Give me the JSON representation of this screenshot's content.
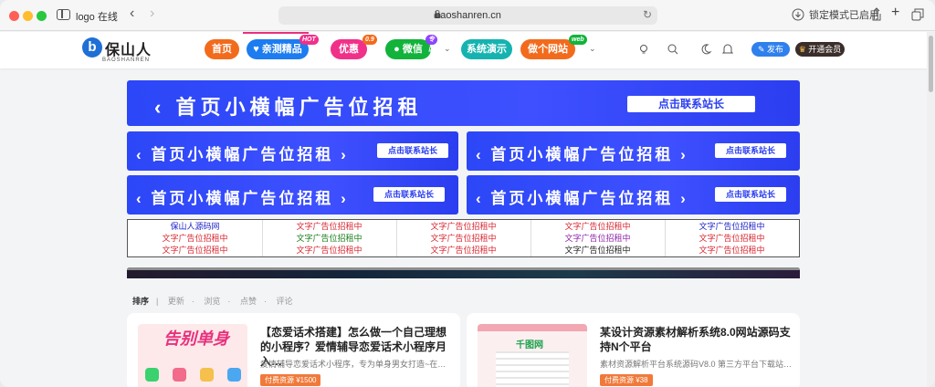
{
  "browser": {
    "tab_title": "logo 在线",
    "url": "baoshanren.cn",
    "lock_mode": "锁定模式已启用"
  },
  "site": {
    "logo_text": "保山人",
    "logo_sub": "BAOSHANREN",
    "nav": [
      {
        "label": "首页",
        "color": "#f26b1d"
      },
      {
        "label": "亲测精品",
        "color": "#1c7cf0",
        "badge": "HOT"
      },
      {
        "label": "优惠",
        "color": "#f0318a",
        "badge": "0.9"
      },
      {
        "label": "微信",
        "color": "#12b33b",
        "badge": "专区"
      },
      {
        "label": "系统演示",
        "color": "#14b3b0"
      },
      {
        "label": "做个网站",
        "color": "#f26b1d",
        "badge": "web"
      }
    ],
    "publish_label": "发布",
    "vip_label": "开通会员"
  },
  "ads": {
    "main_text": "‹ 首页小横幅广告位招租",
    "main_cta": "点击联系站长",
    "small_text": "‹ 首页小横幅广告位招租 ›",
    "small_cta": "点击联系站长"
  },
  "text_ads": [
    [
      "保山人源码网",
      "文字广告位招租中",
      "文字广告位招租中",
      "文字广告位招租中",
      "文字广告位招租中"
    ],
    [
      "文字广告位招租中",
      "文字广告位招租中",
      "文字广告位招租中",
      "文字广告位招租中",
      "文字广告位招租中"
    ],
    [
      "文字广告位招租中",
      "文字广告位招租中",
      "文字广告位招租中",
      "文字广告位招租中",
      "文字广告位招租中"
    ]
  ],
  "text_ad_colors": [
    [
      "#1e22c9",
      "#d8252f",
      "#d8252f",
      "#d8252f",
      "#1e22c9"
    ],
    [
      "#d8252f",
      "#1a7b1a",
      "#d8252f",
      "#8e24aa",
      "#d8252f"
    ],
    [
      "#d8252f",
      "#d8252f",
      "#d8252f",
      "#222222",
      "#d8252f"
    ]
  ],
  "sort": {
    "label": "排序",
    "options": [
      "更新",
      "浏览",
      "点赞",
      "评论"
    ]
  },
  "cards": [
    {
      "title": "【恋爱话术搭建】怎么做一个自己理想的小程序？爱情辅导恋爱话术小程序月入…",
      "desc": "爱情辅导恋爱话术小程序，专为单身男女打造~在…",
      "tag": "付费资源 ¥1500",
      "thumb_text": "告别单身"
    },
    {
      "title": "某设计资源素材解析系统8.0网站源码支持N个平台",
      "desc": "素材资源解析平台系统源码V8.0 第三方平台下载站…",
      "tag": "付费资源 ¥38",
      "thumb_text": "千图网"
    }
  ]
}
